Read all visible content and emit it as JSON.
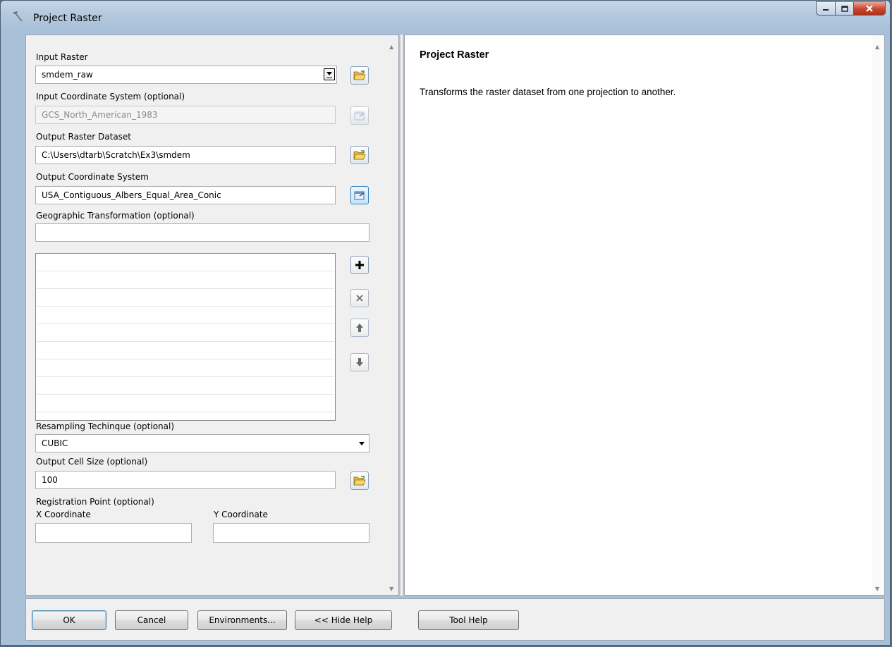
{
  "window": {
    "title": "Project Raster",
    "icon": "hammer-icon",
    "controls": [
      "minimize-icon",
      "maximize-icon",
      "close-icon"
    ]
  },
  "form": {
    "input_raster": {
      "label": "Input Raster",
      "value": "smdem_raw"
    },
    "input_coordinate_system": {
      "label": "Input Coordinate System (optional)",
      "value": "GCS_North_American_1983"
    },
    "output_raster_dataset": {
      "label": "Output Raster Dataset",
      "value": "C:\\Users\\dtarb\\Scratch\\Ex3\\smdem"
    },
    "output_coordinate_system": {
      "label": "Output Coordinate System",
      "value": "USA_Contiguous_Albers_Equal_Area_Conic"
    },
    "geographic_transformation": {
      "label": "Geographic Transformation (optional)",
      "value": "",
      "list_items": []
    },
    "resampling_technique": {
      "label": "Resampling Techinque (optional)",
      "value": "CUBIC"
    },
    "output_cell_size": {
      "label": "Output Cell Size (optional)",
      "value": "100"
    },
    "registration_point": {
      "label": "Registration Point (optional)",
      "x_label": "X Coordinate",
      "x_value": "",
      "y_label": "Y Coordinate",
      "y_value": ""
    }
  },
  "help": {
    "title": "Project Raster",
    "description": "Transforms the raster dataset from one projection to another."
  },
  "buttons": {
    "ok": "OK",
    "cancel": "Cancel",
    "environments": "Environments...",
    "hide_help": "<< Hide Help",
    "tool_help": "Tool Help"
  },
  "colors": {
    "window_frame": "#a9c0d9",
    "panel_bg": "#f0f0f0",
    "close_button": "#c7442d",
    "folder_yellow": "#f2c94c"
  }
}
